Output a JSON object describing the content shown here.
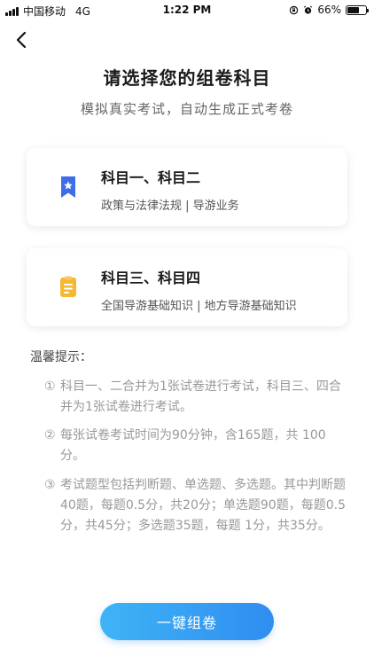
{
  "status_bar": {
    "carrier": "中国移动",
    "network": "4G",
    "time": "1:22 PM",
    "battery": "66%",
    "battery_level": 0.66
  },
  "header": {
    "back_icon": "chevron-left-icon"
  },
  "page": {
    "title": "请选择您的组卷科目",
    "subtitle": "模拟真实考试，自动生成正式考卷"
  },
  "cards": [
    {
      "title": "科目一、科目二",
      "desc": "政策与法律法规 | 导游业务",
      "icon": "bookmark-star-icon",
      "icon_color": "#3d6de8"
    },
    {
      "title": "科目三、科目四",
      "desc": "全国导游基础知识 | 地方导游基础知识",
      "icon": "clipboard-icon",
      "icon_color": "#f6b733"
    }
  ],
  "tips": {
    "title": "温馨提示：",
    "items": [
      {
        "num": "①",
        "text": "科目一、二合并为1张试卷进行考试，科目三、四合并为1张试卷进行考试。"
      },
      {
        "num": "②",
        "text": "每张试卷考试时间为90分钟，含165题，共 100分。"
      },
      {
        "num": "③",
        "text": "考试题型包括判断题、单选题、多选题。其中判断题40题，每题0.5分，共20分；单选题90题，每题0.5分，共45分；多选题35题，每题 1分，共35分。"
      }
    ]
  },
  "action": {
    "label": "一键组卷",
    "color_start": "#3fb4f6",
    "color_end": "#2f8df0"
  }
}
